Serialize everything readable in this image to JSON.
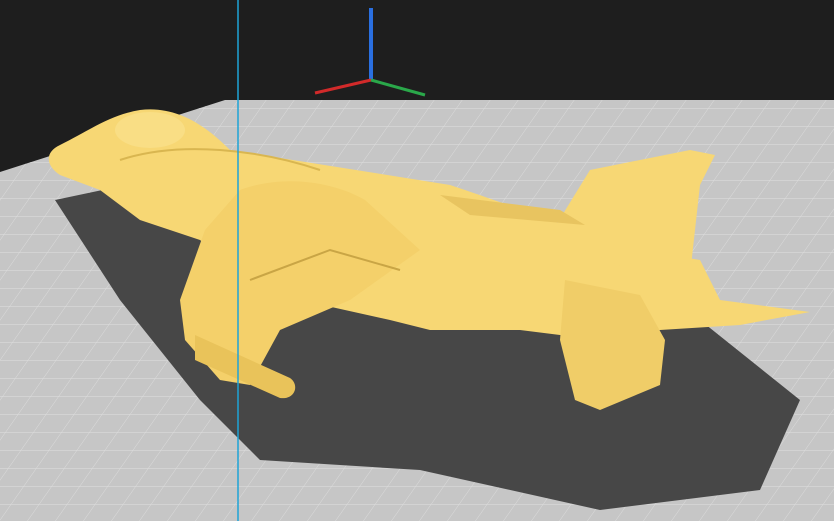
{
  "viewport": {
    "background_color": "#1e1e1e",
    "build_plate_color": "#c8c8c8",
    "grid_color": "#dcdcdc",
    "shadow_color": "#444444",
    "model_color": "#f7d774",
    "model_shade_color": "#d9b650"
  },
  "axes": {
    "x_color": "#d22a2a",
    "y_color": "#2aa84a",
    "z_color": "#2a6fe0"
  },
  "cursor_line_color": "#1fa3d6",
  "model": {
    "icon": "aircraft-model"
  }
}
